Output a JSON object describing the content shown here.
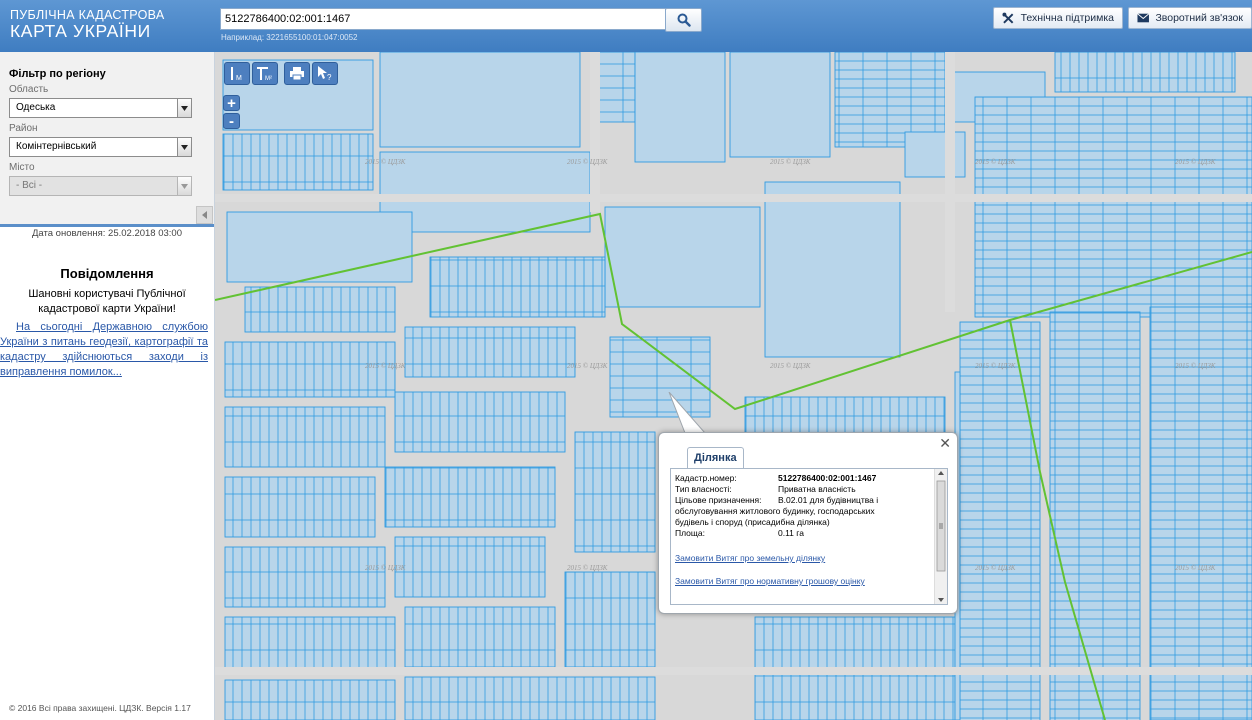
{
  "header": {
    "logo_line1": "ПУБЛІЧНА КАДАСТРОВА",
    "logo_line2": "КАРТА УКРАЇНИ",
    "search_value": "5122786400:02:001:1467",
    "search_example": "Наприклад: 3221655100:01:047:0052",
    "support_label": "Технічна підтримка",
    "feedback_label": "Зворотний зв'язок"
  },
  "sidebar": {
    "filter_title": "Фільтр по регіону",
    "oblast_label": "Область",
    "oblast_value": "Одеська",
    "raion_label": "Район",
    "raion_value": "Комінтернівський",
    "misto_label": "Місто",
    "misto_value": "- Всі -",
    "update_date": "Дата оновлення: 25.02.2018 03:00",
    "message_title": "Повідомлення",
    "message_greeting": "Шановні користувачі Публічної кадастрової карти України!",
    "message_link": "На сьогодні Державною службою України з питань геодезії, картографії та кадастру здійснюються заходи із виправлення помилок...",
    "copyright": "© 2016 Всі права захищені. ЦДЗК. Версія 1.17"
  },
  "map": {
    "watermark": "2015 © ЦДЗК",
    "zoom_in": "+",
    "zoom_out": "-",
    "tool_m": "M",
    "tool_m2": "M²",
    "parcel_fill": "#b8d5ea",
    "parcel_stroke": "#2f9be0",
    "boundary_color": "#62c233"
  },
  "popup": {
    "tab_label": "Ділянка",
    "cad_label": "Кадастр.номер:",
    "cad_value": "5122786400:02:001:1467",
    "ownership_label": "Тип власності:",
    "ownership_value": "Приватна власність",
    "purpose_label": "Цільове призначення:",
    "purpose_value": "В.02.01 для будівництва і обслуговування житлового будинку, господарських будівель і споруд (присадибна ділянка)",
    "area_label": "Площа:",
    "area_value": "0.11 га",
    "link1": "Замовити Витяг про земельну ділянку",
    "link2": "Замовити Витяг про нормативну грошову оцінку"
  }
}
